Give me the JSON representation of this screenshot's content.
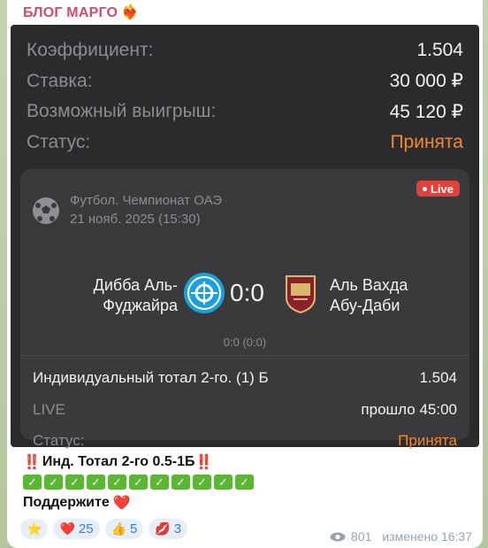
{
  "channel": {
    "name": "БЛОГ МАРГО",
    "name_emoji": "❤‍🔥"
  },
  "summary": {
    "coef_label": "Коэффициент:",
    "coef_value": "1.504",
    "stake_label": "Ставка:",
    "stake_value": "30 000 ₽",
    "payout_label": "Возможный выигрыш:",
    "payout_value": "45 120 ₽",
    "status_label": "Статус:",
    "status_value": "Принята"
  },
  "event": {
    "league": "Футбол. Чемпионат ОАЭ",
    "date": "21 нояб. 2025 (15:30)",
    "live_label": "Live",
    "home_line1": "Дибба Аль-",
    "home_line2": "Фуджайра",
    "score": "0:0",
    "away_line1": "Аль Вахда",
    "away_line2": "Абу-Даби",
    "sub_score": "0:0 (0:0)"
  },
  "bet": {
    "market": "Индивидуальный тотал 2-го. (1) Б",
    "odds": "1.504",
    "live_label": "LIVE",
    "elapsed": "прошло 45:00",
    "status_label": "Статус:",
    "status_value": "Принята"
  },
  "caption": {
    "line1_prefix": "‼️",
    "line1_text": "Инд. Тотал 2-го 0.5-1Б",
    "line1_suffix": "‼️",
    "check_glyph": "✓",
    "line3_text": "Поддержите",
    "line3_emoji": "❤️"
  },
  "reactions": [
    {
      "emoji": "⭐",
      "count": ""
    },
    {
      "emoji": "❤️",
      "count": "25"
    },
    {
      "emoji": "👍",
      "count": "5"
    },
    {
      "emoji": "💋",
      "count": "3"
    }
  ],
  "meta": {
    "views": "801",
    "edited": "изменено 16:37"
  },
  "colors": {
    "accent_orange": "#ef8a2e",
    "live_red": "#e2403b",
    "check_green": "#5bb536",
    "channel_pink": "#d14b6a"
  }
}
